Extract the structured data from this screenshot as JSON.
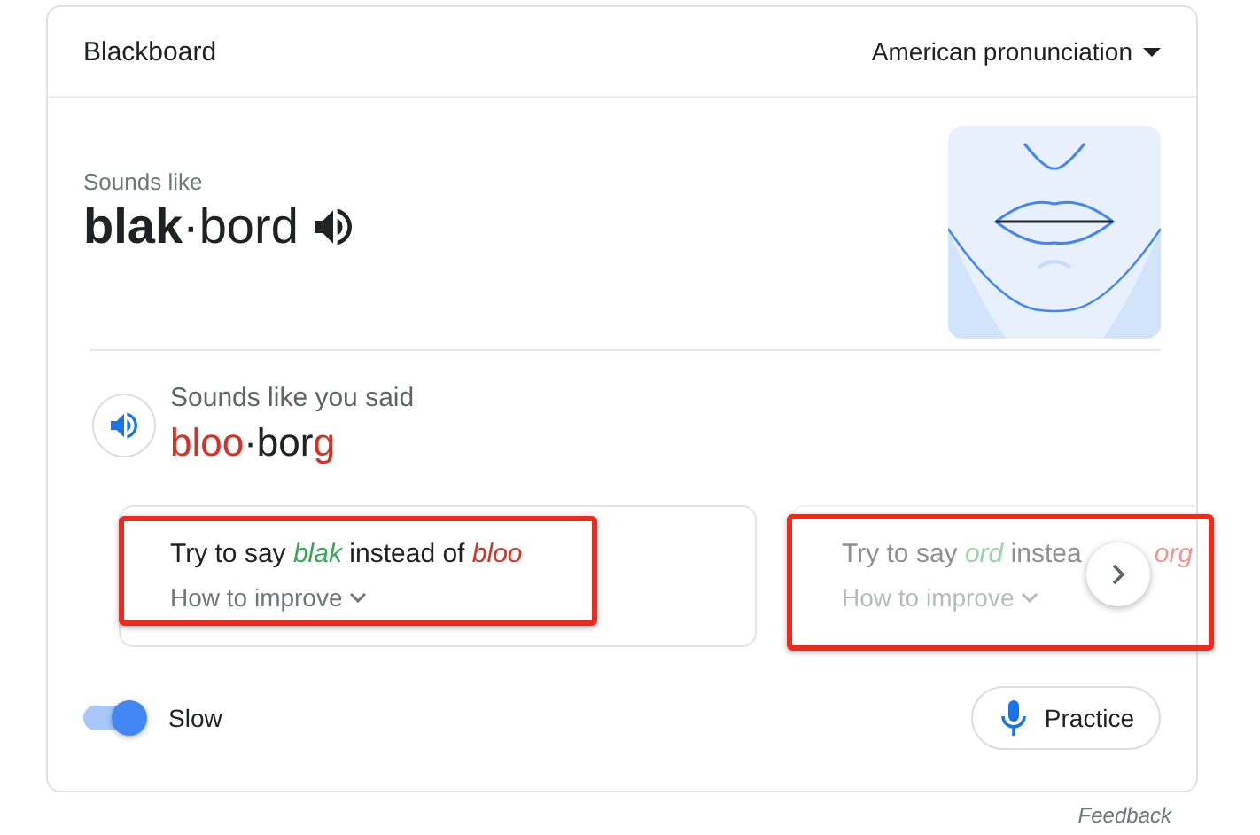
{
  "header": {
    "title": "Blackboard",
    "accent_menu": "American pronunciation"
  },
  "pronunciation": {
    "caption": "Sounds like",
    "syllables": [
      {
        "text": "blak",
        "stressed": true
      },
      {
        "text": "·",
        "stressed": false
      },
      {
        "text": "bord",
        "stressed": false
      }
    ]
  },
  "attempt": {
    "caption": "Sounds like you said",
    "syllables": [
      {
        "text": "bloo",
        "wrong": true
      },
      {
        "text": "·",
        "wrong": false
      },
      {
        "text": "bor",
        "wrong": false
      },
      {
        "text": "g",
        "wrong": true
      }
    ]
  },
  "tips": [
    {
      "active": true,
      "highlighted": true,
      "parts": [
        {
          "kind": "plain",
          "text": "Try to say "
        },
        {
          "kind": "target",
          "text": "blak"
        },
        {
          "kind": "plain",
          "text": " instead of "
        },
        {
          "kind": "said",
          "text": "bloo"
        }
      ],
      "link": "How to improve"
    },
    {
      "active": false,
      "highlighted": true,
      "parts": [
        {
          "kind": "plain",
          "text": "Try to say "
        },
        {
          "kind": "target",
          "text": "ord"
        },
        {
          "kind": "plain",
          "text": " instea"
        }
      ],
      "tail_parts": [
        {
          "kind": "said",
          "text": "org"
        }
      ],
      "link": "How to improve"
    }
  ],
  "slow": {
    "label": "Slow",
    "on": true
  },
  "practice_button": "Practice",
  "feedback": "Feedback"
}
